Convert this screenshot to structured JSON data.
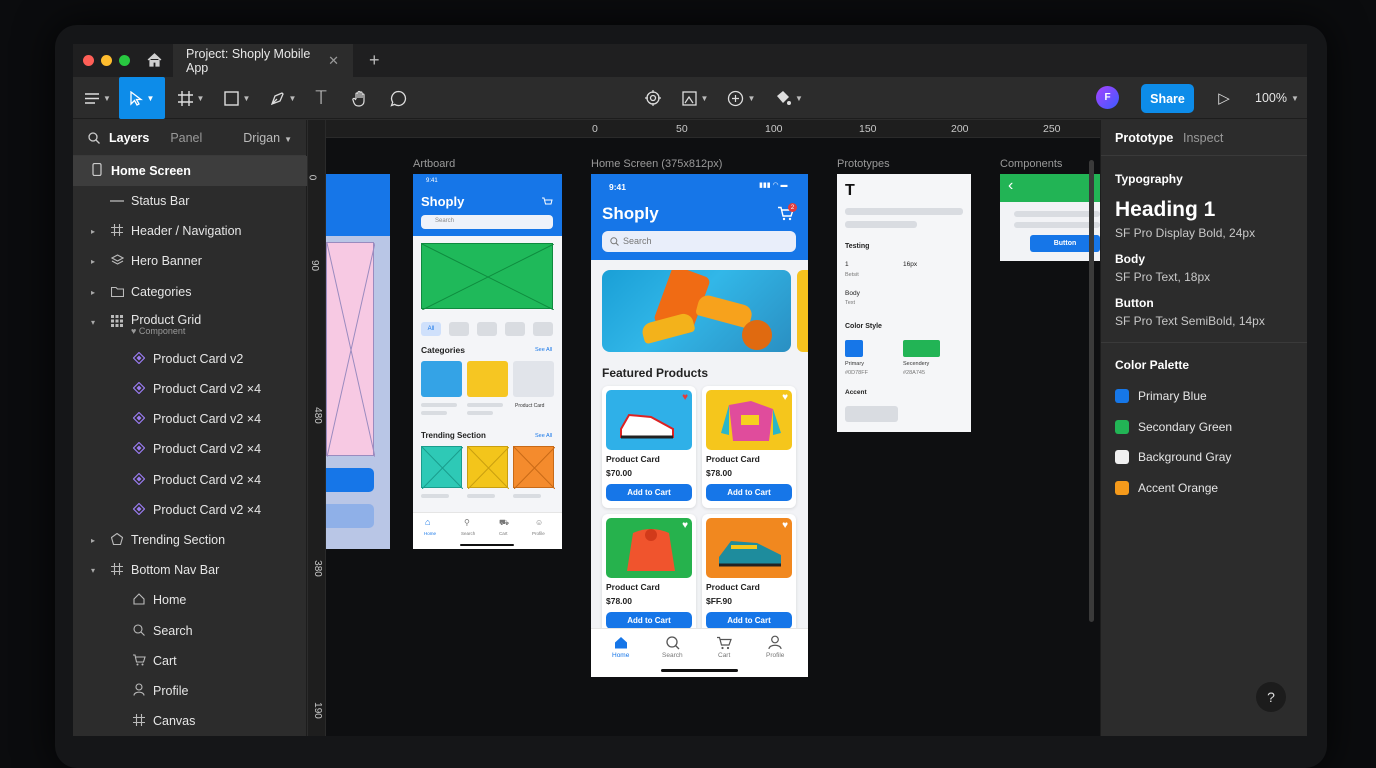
{
  "window": {
    "tab_title": "Project: Shoply Mobile App",
    "close_glyph": "✕",
    "new_tab_glyph": "+",
    "home_icon": "home-icon"
  },
  "toolbar": {
    "share_label": "Share",
    "zoom_label": "100%",
    "avatar_initial": "F",
    "text_tool_glyph": "T",
    "play_glyph": "▷"
  },
  "left_panel": {
    "tabs": [
      "Layers",
      "Panel"
    ],
    "page_selector": "Drigan",
    "layers": [
      {
        "label": "Home Screen",
        "icon": "phone-icon",
        "selected": true
      },
      {
        "label": "Status Bar",
        "icon": "line-icon"
      },
      {
        "label": "Header / Navigation",
        "icon": "frame-icon"
      },
      {
        "label": "Hero Banner",
        "icon": "stack-icon"
      },
      {
        "label": "Categories",
        "icon": "folder-icon"
      },
      {
        "label": "Product Grid",
        "icon": "grid-icon",
        "sub": "♥ Component"
      },
      {
        "label": "Product Card v2",
        "icon": "component-icon"
      },
      {
        "label": "Product Card v2 ×4",
        "icon": "component-icon"
      },
      {
        "label": "Product Card v2 ×4",
        "icon": "component-icon"
      },
      {
        "label": "Product Card v2 ×4",
        "icon": "component-icon"
      },
      {
        "label": "Product Card v2 ×4",
        "icon": "component-icon"
      },
      {
        "label": "Product Card v2 ×4",
        "icon": "component-icon"
      },
      {
        "label": "Trending Section",
        "icon": "shape-icon"
      },
      {
        "label": "Bottom Nav Bar",
        "icon": "frame-icon"
      },
      {
        "label": "Home",
        "icon": "home-icon"
      },
      {
        "label": "Search",
        "icon": "search-icon"
      },
      {
        "label": "Cart",
        "icon": "cart-icon"
      },
      {
        "label": "Profile",
        "icon": "user-icon"
      },
      {
        "label": "Canvas",
        "icon": "frame-icon"
      }
    ]
  },
  "ruler": {
    "top": [
      "0",
      "50",
      "100",
      "150",
      "200",
      "250"
    ],
    "left": [
      "0",
      "90",
      "480",
      "380",
      "190"
    ]
  },
  "canvas": {
    "frame_labels": {
      "artboard": "Artboard",
      "home": "Home Screen (375x812px)",
      "prototypes": "Prototypes",
      "components": "Components"
    },
    "home": {
      "time": "9:41",
      "brand": "Shoply",
      "search_placeholder": "Search",
      "section_title": "Featured Products",
      "cart_badge": "2",
      "products": [
        {
          "name": "Product Card",
          "price": "$70.00",
          "cta": "Add to Cart"
        },
        {
          "name": "Product Card",
          "price": "$78.00",
          "cta": "Add to Cart"
        },
        {
          "name": "Product Card",
          "price": "$78.00",
          "cta": "Add to Cart"
        },
        {
          "name": "Product Card",
          "price": "$FF.90",
          "cta": "Add to Cart"
        }
      ],
      "nav": [
        "Home",
        "Search",
        "Cart",
        "Profile"
      ]
    },
    "artboard": {
      "time": "9:41",
      "brand": "Shoply",
      "search_placeholder": "Search",
      "chip_all": "All",
      "categories_title": "Categories",
      "see_all": "See All",
      "product_card_label": "Product Card",
      "trending_title": "Trending Section",
      "see_all_2": "See All",
      "nav": [
        "Home",
        "Search",
        "Cart",
        "Profile"
      ]
    },
    "prototypes": {
      "big_t": "T",
      "testing": "Testing",
      "one": "1",
      "sixteen": "16px",
      "betsit": "Betsit",
      "body": "Body",
      "text": "Text",
      "color_style": "Color Style",
      "primary": "Primary",
      "primary_hex": "#0D78FF",
      "secondary": "Secendery",
      "secondary_hex": "#28A745",
      "accent": "Accent"
    },
    "components": {
      "button_label": "Button",
      "back_glyph": "‹"
    }
  },
  "right_panel": {
    "tabs": [
      "Prototype",
      "Inspect"
    ],
    "typography_title": "Typography",
    "heading": "Heading 1",
    "heading_spec": "SF Pro Display Bold, 24px",
    "body": "Body",
    "body_spec": "SF Pro Text, 18px",
    "button": "Button",
    "button_spec": "SF Pro Text SemiBold, 14px",
    "palette_title": "Color Palette",
    "colors": [
      {
        "name": "Primary Blue",
        "hex": "#1677e8"
      },
      {
        "name": "Secondary Green",
        "hex": "#22b455"
      },
      {
        "name": "Background Gray",
        "hex": "#f0f0f0"
      },
      {
        "name": "Accent Orange",
        "hex": "#f59a1b"
      }
    ],
    "help_glyph": "?"
  }
}
